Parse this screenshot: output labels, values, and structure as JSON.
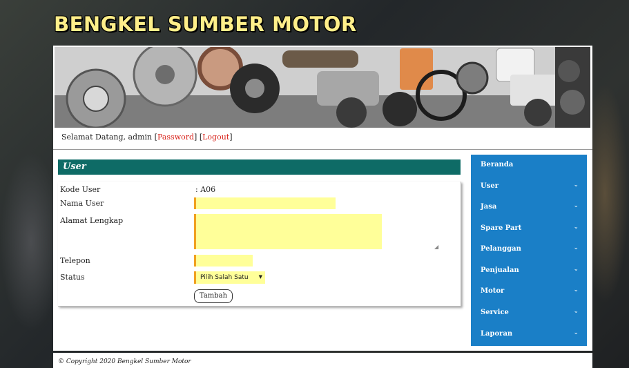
{
  "site": {
    "title": "BENGKEL SUMBER MOTOR"
  },
  "welcome": {
    "prefix": "Selamat Datang, admin [",
    "password": "Password",
    "mid": "] [",
    "logout": "Logout",
    "suffix": "]"
  },
  "section": {
    "title": "User"
  },
  "form": {
    "kode_label": "Kode User",
    "kode_value": ": A06",
    "nama_label": "Nama User",
    "alamat_label": "Alamat Lengkap",
    "telepon_label": "Telepon",
    "status_label": "Status",
    "status_selected": "Pilih Salah Satu",
    "submit_label": "Tambah"
  },
  "sidebar": {
    "items": [
      {
        "label": "Beranda",
        "chevron": ""
      },
      {
        "label": "User",
        "chevron": "⌄"
      },
      {
        "label": "Jasa",
        "chevron": "⌄"
      },
      {
        "label": "Spare Part",
        "chevron": "⌄"
      },
      {
        "label": "Pelanggan",
        "chevron": "⌄"
      },
      {
        "label": "Penjualan",
        "chevron": "⌄"
      },
      {
        "label": "Motor",
        "chevron": "⌄"
      },
      {
        "label": "Service",
        "chevron": "⌄"
      },
      {
        "label": "Laporan",
        "chevron": "⌄"
      }
    ]
  },
  "footer": {
    "text": "© Copyright 2020 Bengkel Sumber Motor"
  },
  "colors": {
    "header_bar": "#0e6b66",
    "sidebar": "#1a7fc7",
    "input_bg": "#ffff99",
    "input_accent": "#f0a020",
    "title": "#ffef8a",
    "link": "#d9241c"
  }
}
